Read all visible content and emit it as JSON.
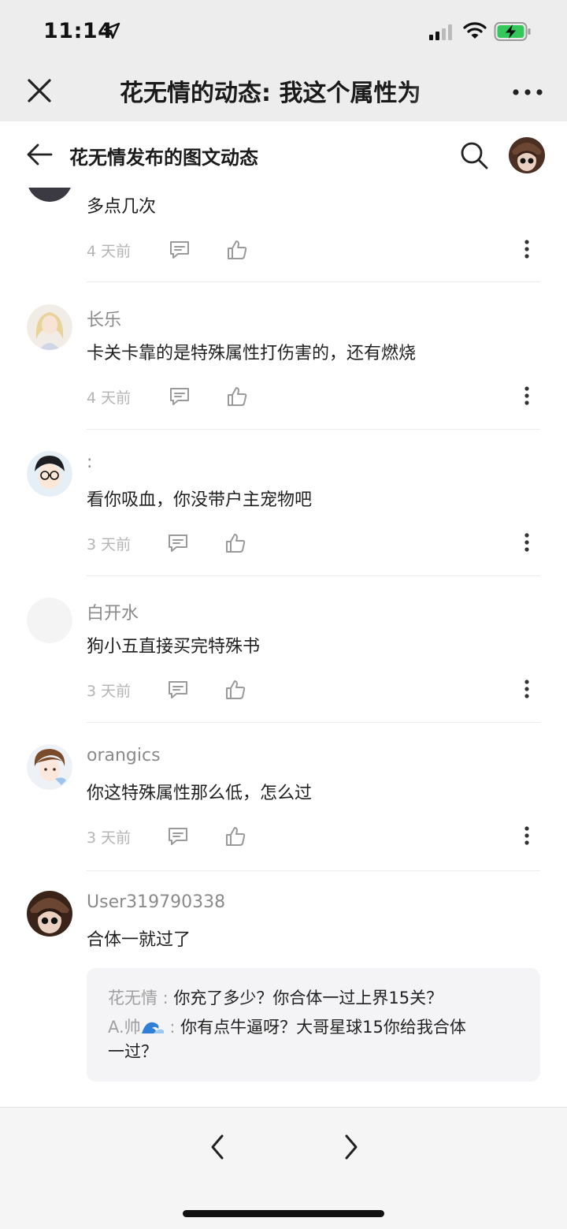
{
  "status_bar": {
    "time": "11:14"
  },
  "browser": {
    "title": "花无情的动态: 我这个属性为"
  },
  "header": {
    "title": "花无情发布的图文动态"
  },
  "comments": [
    {
      "username": "",
      "text": "多点几次",
      "time": "4 天前"
    },
    {
      "username": "长乐",
      "text": "卡关卡靠的是特殊属性打伤害的，还有燃烧",
      "time": "4 天前"
    },
    {
      "username": ":",
      "text": "看你吸血，你没带户主宠物吧",
      "time": "3 天前"
    },
    {
      "username": "白开水",
      "text": "狗小五直接买完特殊书",
      "time": "3 天前"
    },
    {
      "username": "orangics",
      "text": "你这特殊属性那么低，怎么过",
      "time": "3 天前"
    },
    {
      "username": "User319790338",
      "text": "合体一就过了"
    }
  ],
  "replies": [
    {
      "author": "花无情",
      "sep": " : ",
      "text": "你充了多少？你合体一过上界15关？"
    },
    {
      "author": "A.帅",
      "sep": " : ",
      "text": "你有点牛逼呀？大哥星球15你给我合体"
    },
    {
      "text": "一过？"
    }
  ],
  "colors": {
    "accent_battery": "#34c759",
    "background": "#ffffff",
    "chrome": "#ededed"
  },
  "icons": [
    "close-icon",
    "more-icon",
    "back-icon",
    "search-icon",
    "reply-icon",
    "like-icon",
    "kebab-icon",
    "prev-icon",
    "next-icon",
    "wave-icon"
  ]
}
